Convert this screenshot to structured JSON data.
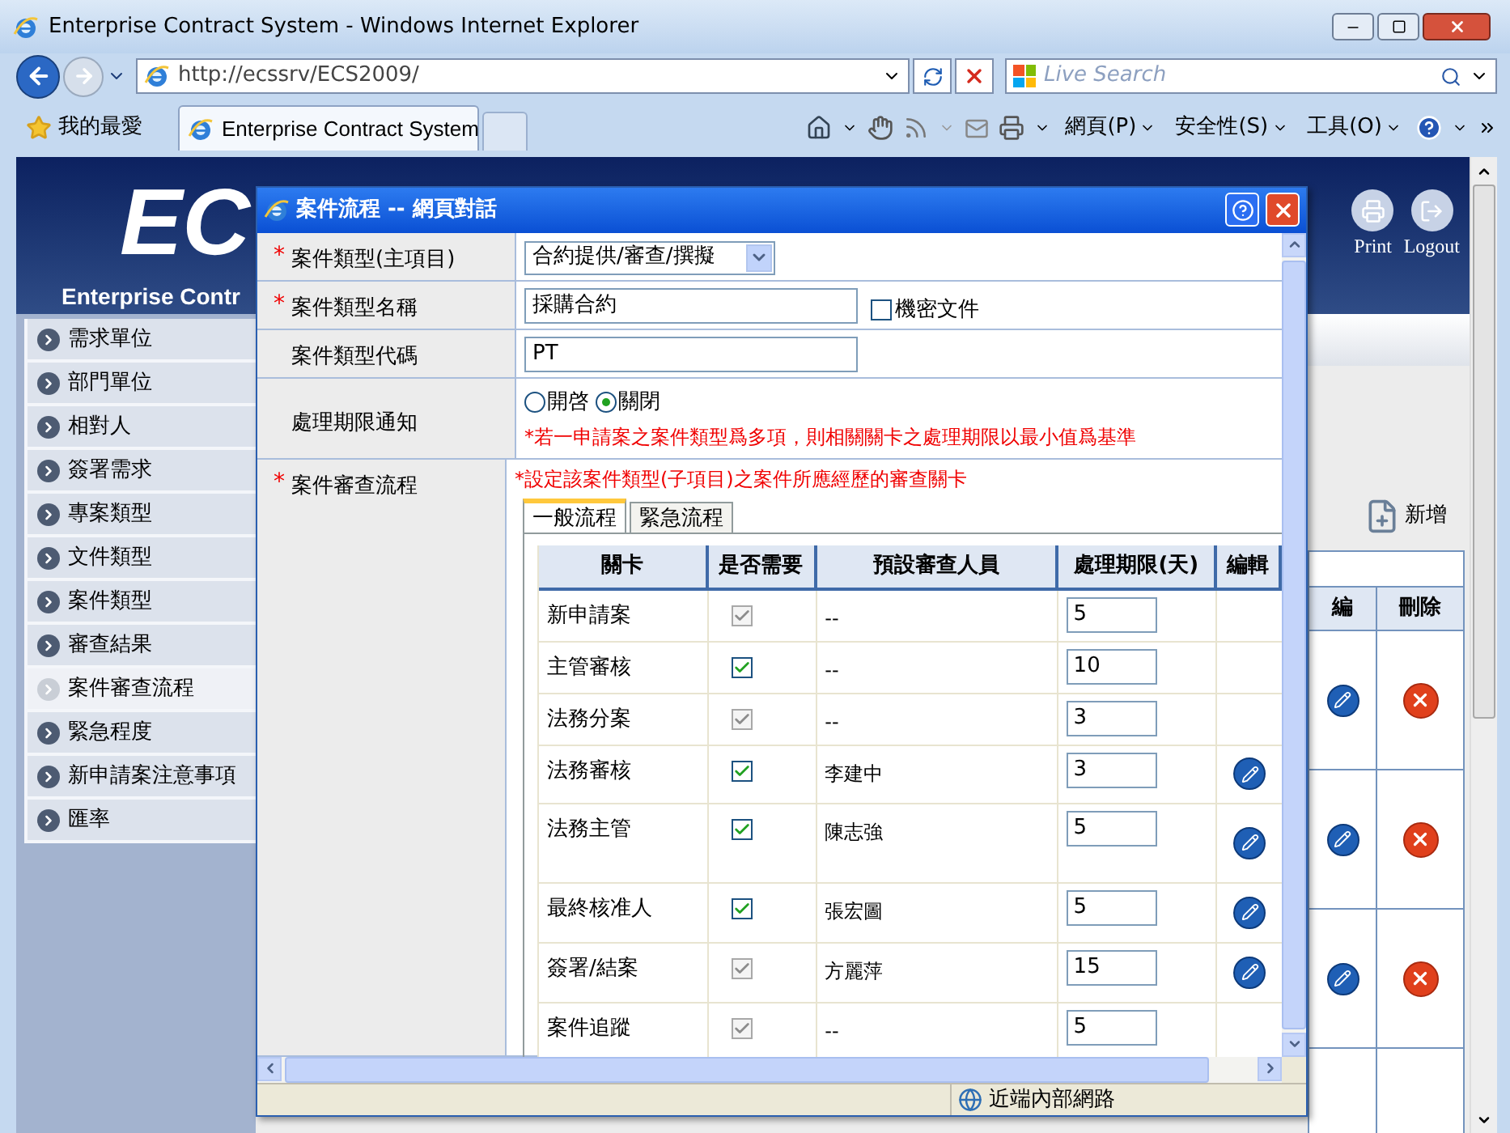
{
  "window": {
    "title": "Enterprise Contract System - Windows Internet Explorer"
  },
  "address_bar": {
    "url": "http://ecssrv/ECS2009/"
  },
  "search": {
    "placeholder": "Live Search"
  },
  "favorites": {
    "label": "我的最愛"
  },
  "tabs": [
    {
      "label": "Enterprise Contract System",
      "selected": true
    }
  ],
  "command_bar": {
    "menus": [
      "網頁(P)",
      "安全性(S)",
      "工具(O)"
    ]
  },
  "page": {
    "logo": "EC",
    "subtitle": "Enterprise Contr",
    "header_buttons": [
      {
        "kind": "print",
        "label": "Print"
      },
      {
        "kind": "logout",
        "label": "Logout"
      }
    ],
    "sidebar": {
      "items": [
        {
          "label": "需求單位",
          "selected": false
        },
        {
          "label": "部門單位",
          "selected": false
        },
        {
          "label": "相對人",
          "selected": false
        },
        {
          "label": "簽署需求",
          "selected": false
        },
        {
          "label": "專案類型",
          "selected": false
        },
        {
          "label": "文件類型",
          "selected": false
        },
        {
          "label": "案件類型",
          "selected": false
        },
        {
          "label": "審查結果",
          "selected": false
        },
        {
          "label": "案件審查流程",
          "selected": true
        },
        {
          "label": "緊急程度",
          "selected": false
        },
        {
          "label": "新申請案注意事項",
          "selected": false
        },
        {
          "label": "匯率",
          "selected": false
        }
      ]
    },
    "add_button": "新增",
    "table": {
      "columns": [
        "編",
        "刪除"
      ],
      "rows": [
        {
          "edit": true,
          "delete": true
        },
        {
          "edit": true,
          "delete": true
        },
        {
          "edit": true,
          "delete": true
        },
        {
          "edit": false,
          "delete": false
        }
      ]
    }
  },
  "dialog": {
    "title": "案件流程 -- 網頁對話",
    "fields": [
      {
        "kind": "select",
        "mark": "*",
        "label": "案件類型(主項目)",
        "value": "合約提供/審查/撰擬"
      },
      {
        "kind": "text",
        "mark": "*",
        "label": "案件類型名稱",
        "value": "採購合約",
        "checkbox": {
          "label": "機密文件",
          "checked": false
        }
      },
      {
        "kind": "text",
        "label": "案件類型代碼",
        "value": "PT"
      },
      {
        "kind": "radio",
        "label": "處理期限通知",
        "options": [
          {
            "label": "開啓",
            "selected": false
          },
          {
            "label": "關閉",
            "selected": true
          }
        ],
        "note": "*若一申請案之案件類型爲多項，則相關關卡之處理期限以最小值爲基準"
      },
      {
        "kind": "flow",
        "mark": "*",
        "label": "案件審查流程",
        "note": "*設定該案件類型(子項目)之案件所應經歷的審查關卡",
        "tabs": [
          {
            "label": "一般流程",
            "selected": true
          },
          {
            "label": "緊急流程",
            "selected": false
          }
        ],
        "columns": [
          "關卡",
          "是否需要",
          "預設審查人員",
          "處理期限(天)",
          "編輯"
        ],
        "rows": [
          {
            "stage": "新申請案",
            "checked": true,
            "disabled": true,
            "reviewer": "--",
            "days": "5",
            "editable": false
          },
          {
            "stage": "主管審核",
            "checked": true,
            "disabled": false,
            "reviewer": "--",
            "days": "10",
            "editable": false
          },
          {
            "stage": "法務分案",
            "checked": true,
            "disabled": true,
            "reviewer": "--",
            "days": "3",
            "editable": false
          },
          {
            "stage": "法務審核",
            "checked": true,
            "disabled": false,
            "reviewer": "李建中",
            "days": "3",
            "editable": true
          },
          {
            "stage": "法務主管",
            "checked": true,
            "disabled": false,
            "reviewer": "陳志強",
            "days": "5",
            "editable": true
          },
          {
            "stage": "最終核准人",
            "checked": true,
            "disabled": false,
            "reviewer": "張宏圖",
            "days": "5",
            "editable": true
          },
          {
            "stage": "簽署/結案",
            "checked": true,
            "disabled": true,
            "reviewer": "方麗萍",
            "days": "15",
            "editable": true
          },
          {
            "stage": "案件追蹤",
            "checked": true,
            "disabled": true,
            "reviewer": "--",
            "days": "5",
            "editable": false
          }
        ]
      }
    ],
    "status": "近端內部網路"
  }
}
